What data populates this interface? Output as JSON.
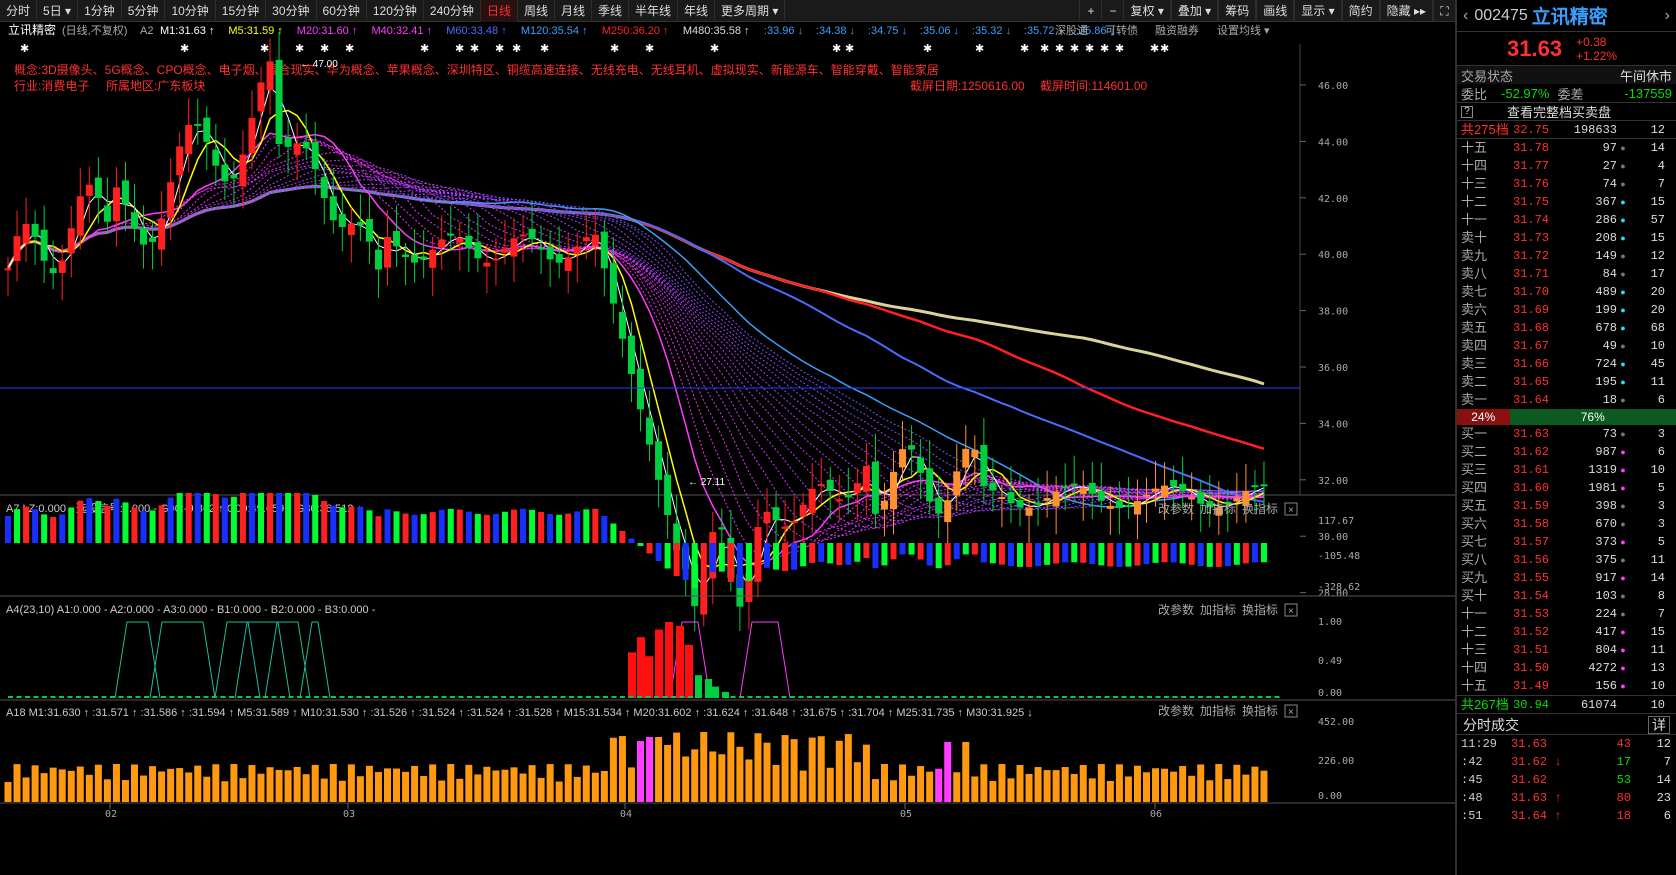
{
  "toolbar": {
    "periods": [
      "分时",
      "5日",
      "1分钟",
      "5分钟",
      "10分钟",
      "15分钟",
      "30分钟",
      "60分钟",
      "120分钟",
      "240分钟",
      "日线",
      "周线",
      "月线",
      "季线",
      "半年线",
      "年线",
      "更多周期"
    ],
    "active_period": "日线",
    "tools": [
      "复权",
      "叠加",
      "筹码",
      "画线",
      "显示",
      "简约",
      "隐藏"
    ]
  },
  "main_chart": {
    "stock_title": "立讯精密",
    "mode": "(日线,不复权)",
    "ma_legend": [
      {
        "label": "M1:31.63",
        "color": "#ffffff"
      },
      {
        "label": "M5:31.59",
        "color": "#ffff00"
      },
      {
        "label": "M20:31.60",
        "color": "#ff3cff"
      },
      {
        "label": "M40:32.41",
        "color": "#ff3cff"
      },
      {
        "label": "M60:33.48",
        "color": "#4a6bff"
      },
      {
        "label": "M120:35.54",
        "color": "#3aa0ff"
      },
      {
        "label": "M250:36.20",
        "color": "#ff2020"
      },
      {
        "label": "M480:35.58",
        "color": "#ddd"
      }
    ],
    "ma_extra": [
      "33.96",
      "34.38",
      "34.75",
      "35.06",
      "35.32",
      "35.72",
      "35.86"
    ],
    "extra_tags": [
      "深股通",
      "可转债",
      "融资融券",
      "设置均线"
    ],
    "concepts": "概念:3D摄像头、5G概念、CPO概念、电子烟、混合现实、华为概念、苹果概念、深圳特区、铜缆高速连接、无线充电、无线耳机、虚拟现实、新能源车、智能穿戴、智能家居",
    "industry": "行业:消费电子",
    "region": "所属地区:广东板块",
    "snapshot_date": "截屏日期:1250616.00",
    "snapshot_time": "截屏时间:114601.00",
    "high_label": "47.00",
    "low_label": "27.11",
    "price_ticks": [
      "46.00",
      "44.00",
      "42.00",
      "40.00",
      "38.00",
      "36.00",
      "34.00",
      "32.00",
      "30.00",
      "28.00"
    ],
    "date_ticks": [
      "02",
      "03",
      "04",
      "05",
      "06"
    ]
  },
  "panel_a7": {
    "legend": "A7  LZ:0.000 - 选股信号:0.000 - G00:-9.862 ↑ G00:49.659 ↓ G80:36.512 ↓",
    "ticks": [
      "117.67",
      "-105.48",
      "-328.62"
    ],
    "buttons": [
      "改参数",
      "加指标",
      "换指标"
    ]
  },
  "panel_a4": {
    "legend": "A4(23,10)  A1:0.000 - A2:0.000 - A3:0.000 - B1:0.000 - B2:0.000 - B3:0.000 -",
    "ticks": [
      "1.00",
      "0.49",
      "0.00"
    ],
    "buttons": [
      "改参数",
      "加指标",
      "换指标"
    ]
  },
  "panel_a18": {
    "legend": "A18  M1:31.630 ↑ :31.571 ↑ :31.586 ↑ :31.594 ↑ M5:31.589 ↑ M10:31.530 ↑ :31.526 ↑ :31.524 ↑ :31.524 ↑ :31.528 ↑ M15:31.534 ↑ M20:31.602 ↑ :31.624 ↑ :31.648 ↑ :31.675 ↑ :31.704 ↑ M25:31.735 ↑ M30:31.925 ↓",
    "ticks": [
      "452.00",
      "226.00",
      "0.00"
    ],
    "buttons": [
      "改参数",
      "加指标",
      "换指标"
    ]
  },
  "quote": {
    "code": "002475",
    "name": "立讯精密",
    "price": "31.63",
    "change": "+0.38",
    "change_pct": "+1.22%",
    "status_label": "交易状态",
    "status_value": "午间休市",
    "wb_label": "委比",
    "wb_value": "-52.97%",
    "wc_label": "委差",
    "wc_value": "-137559",
    "full_book": "查看完整档买卖盘",
    "ask_summary": {
      "label": "共275档",
      "price": "32.75",
      "vol": "198633",
      "n": "12"
    },
    "asks": [
      {
        "l": "十五",
        "p": "31.78",
        "v": "97",
        "d": "gray",
        "n": "14"
      },
      {
        "l": "十四",
        "p": "31.77",
        "v": "27",
        "d": "gray",
        "n": "4"
      },
      {
        "l": "十三",
        "p": "31.76",
        "v": "74",
        "d": "gray",
        "n": "7"
      },
      {
        "l": "十二",
        "p": "31.75",
        "v": "367",
        "d": "cyan",
        "n": "15"
      },
      {
        "l": "十一",
        "p": "31.74",
        "v": "286",
        "d": "cyan",
        "n": "57"
      },
      {
        "l": "卖十",
        "p": "31.73",
        "v": "208",
        "d": "cyan",
        "n": "15"
      },
      {
        "l": "卖九",
        "p": "31.72",
        "v": "149",
        "d": "gray",
        "n": "12"
      },
      {
        "l": "卖八",
        "p": "31.71",
        "v": "84",
        "d": "gray",
        "n": "17"
      },
      {
        "l": "卖七",
        "p": "31.70",
        "v": "489",
        "d": "cyan",
        "n": "20"
      },
      {
        "l": "卖六",
        "p": "31.69",
        "v": "199",
        "d": "cyan",
        "n": "20"
      },
      {
        "l": "卖五",
        "p": "31.68",
        "v": "678",
        "d": "cyan",
        "n": "68"
      },
      {
        "l": "卖四",
        "p": "31.67",
        "v": "49",
        "d": "gray",
        "n": "10"
      },
      {
        "l": "卖三",
        "p": "31.66",
        "v": "724",
        "d": "cyan",
        "n": "45"
      },
      {
        "l": "卖二",
        "p": "31.65",
        "v": "195",
        "d": "cyan",
        "n": "11"
      },
      {
        "l": "卖一",
        "p": "31.64",
        "v": "18",
        "d": "gray",
        "n": "6"
      }
    ],
    "split": {
      "left": "24%",
      "right": "76%"
    },
    "bids": [
      {
        "l": "买一",
        "p": "31.63",
        "v": "73",
        "d": "gray",
        "n": "3"
      },
      {
        "l": "买二",
        "p": "31.62",
        "v": "987",
        "d": "mag",
        "n": "6"
      },
      {
        "l": "买三",
        "p": "31.61",
        "v": "1319",
        "d": "mag",
        "n": "10"
      },
      {
        "l": "买四",
        "p": "31.60",
        "v": "1981",
        "d": "mag",
        "n": "5"
      },
      {
        "l": "买五",
        "p": "31.59",
        "v": "398",
        "d": "gray",
        "n": "3"
      },
      {
        "l": "买六",
        "p": "31.58",
        "v": "670",
        "d": "gray",
        "n": "3"
      },
      {
        "l": "买七",
        "p": "31.57",
        "v": "373",
        "d": "mag",
        "n": "5"
      },
      {
        "l": "买八",
        "p": "31.56",
        "v": "375",
        "d": "gray",
        "n": "11"
      },
      {
        "l": "买九",
        "p": "31.55",
        "v": "917",
        "d": "mag",
        "n": "14"
      },
      {
        "l": "买十",
        "p": "31.54",
        "v": "103",
        "d": "gray",
        "n": "8"
      },
      {
        "l": "十一",
        "p": "31.53",
        "v": "224",
        "d": "gray",
        "n": "7"
      },
      {
        "l": "十二",
        "p": "31.52",
        "v": "417",
        "d": "mag",
        "n": "15"
      },
      {
        "l": "十三",
        "p": "31.51",
        "v": "804",
        "d": "mag",
        "n": "11"
      },
      {
        "l": "十四",
        "p": "31.50",
        "v": "4272",
        "d": "mag",
        "n": "13"
      },
      {
        "l": "十五",
        "p": "31.49",
        "v": "156",
        "d": "mag",
        "n": "10"
      }
    ],
    "bid_summary": {
      "label": "共267档",
      "price": "30.94",
      "vol": "61074",
      "n": "10"
    },
    "ticks_title": "分时成交",
    "ticks_detail": "详",
    "ticks": [
      {
        "t": "11:29",
        "p": "31.63",
        "a": "",
        "v": "43",
        "n": "12"
      },
      {
        "t": ":42",
        "p": "31.62",
        "a": "↓",
        "v": "17",
        "n": "7"
      },
      {
        "t": ":45",
        "p": "31.62",
        "a": "",
        "v": "53",
        "n": "14"
      },
      {
        "t": ":48",
        "p": "31.63",
        "a": "↑",
        "v": "80",
        "n": "23"
      },
      {
        "t": ":51",
        "p": "31.64",
        "a": "↑",
        "v": "18",
        "n": "6"
      }
    ]
  }
}
